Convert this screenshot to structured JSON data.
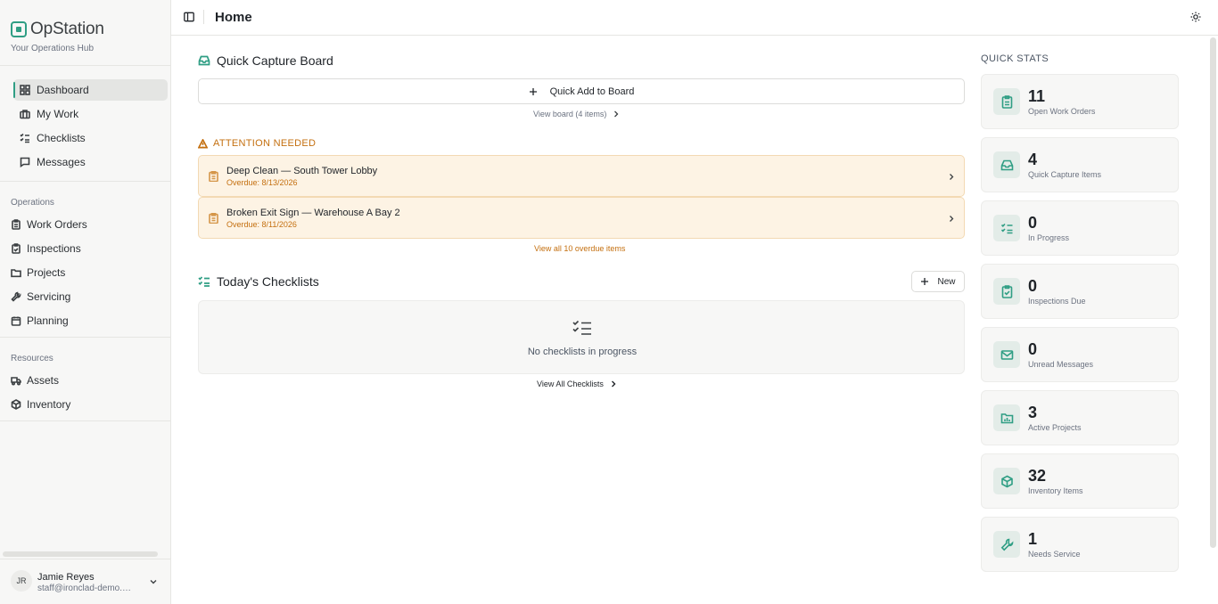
{
  "brand": {
    "name": "OpStation",
    "subtitle": "Your Operations Hub"
  },
  "sidebar": {
    "primary": [
      {
        "label": "Dashboard",
        "icon": "dashboard-icon",
        "active": true
      },
      {
        "label": "My Work",
        "icon": "briefcase-icon"
      },
      {
        "label": "Checklists",
        "icon": "checklist-icon"
      },
      {
        "label": "Messages",
        "icon": "message-icon"
      }
    ],
    "operations_label": "Operations",
    "operations": [
      {
        "label": "Work Orders",
        "icon": "clipboard-icon"
      },
      {
        "label": "Inspections",
        "icon": "clipboard-check-icon"
      },
      {
        "label": "Projects",
        "icon": "folder-icon"
      },
      {
        "label": "Servicing",
        "icon": "wrench-icon"
      },
      {
        "label": "Planning",
        "icon": "calendar-icon"
      }
    ],
    "resources_label": "Resources",
    "resources": [
      {
        "label": "Assets",
        "icon": "truck-icon"
      },
      {
        "label": "Inventory",
        "icon": "box-icon"
      }
    ]
  },
  "user": {
    "initials": "JR",
    "name": "Jamie Reyes",
    "email": "staff@ironclad-demo.com"
  },
  "header": {
    "title": "Home"
  },
  "quick_capture": {
    "title": "Quick Capture Board",
    "add_label": "Quick Add to Board",
    "view_link": "View board (4 items)"
  },
  "attention": {
    "title": "ATTENTION NEEDED",
    "items": [
      {
        "title": "Deep Clean — South Tower Lobby",
        "sub": "Overdue: 8/13/2026"
      },
      {
        "title": "Broken Exit Sign — Warehouse A Bay 2",
        "sub": "Overdue: 8/11/2026"
      }
    ],
    "view_all": "View all 10 overdue items"
  },
  "checklists": {
    "title": "Today's Checklists",
    "new_label": "New",
    "empty_text": "No checklists in progress",
    "view_all": "View All Checklists"
  },
  "quick_stats": {
    "title": "QUICK STATS",
    "items": [
      {
        "value": "11",
        "label": "Open Work Orders",
        "icon": "clipboard-icon"
      },
      {
        "value": "4",
        "label": "Quick Capture Items",
        "icon": "inbox-icon"
      },
      {
        "value": "0",
        "label": "In Progress",
        "icon": "checklist-icon"
      },
      {
        "value": "0",
        "label": "Inspections Due",
        "icon": "clipboard-check-icon"
      },
      {
        "value": "0",
        "label": "Unread Messages",
        "icon": "mail-icon"
      },
      {
        "value": "3",
        "label": "Active Projects",
        "icon": "folder-chart-icon"
      },
      {
        "value": "32",
        "label": "Inventory Items",
        "icon": "box-icon"
      },
      {
        "value": "1",
        "label": "Needs Service",
        "icon": "wrench-icon"
      }
    ]
  },
  "colors": {
    "accent": "#2f9e84",
    "warning": "#c46f0f",
    "warning_bg": "#fdf3e4"
  }
}
